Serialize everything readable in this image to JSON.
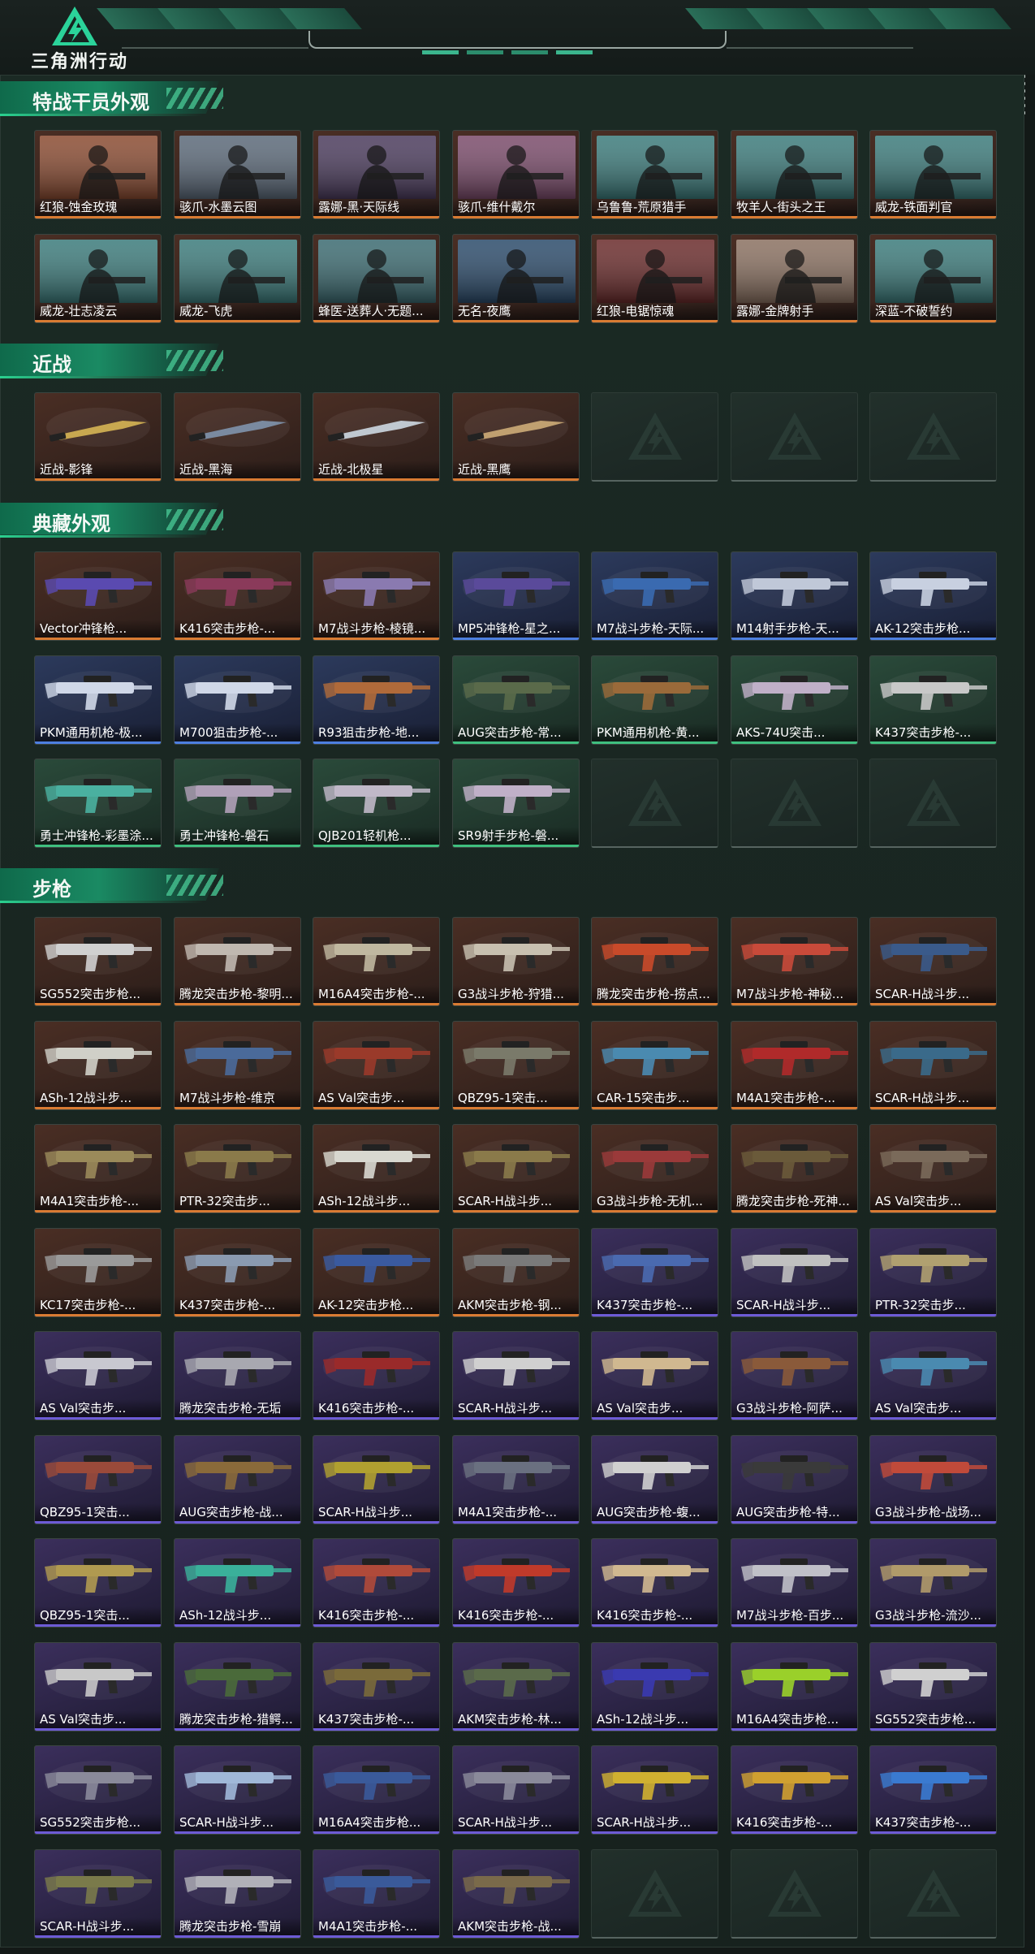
{
  "header": {
    "logo_text": "三角洲行动",
    "logo_icon": "delta-triangle-logo"
  },
  "colors": {
    "accent": "#1a8a63",
    "rarity_orange": "#d97b33",
    "rarity_purple": "#6d5bd6",
    "rarity_blue": "#4d7fe0",
    "rarity_green": "#3fbf7f"
  },
  "sections": [
    {
      "title": "特战干员外观",
      "kind": "operator",
      "empty_count": 0,
      "items": [
        {
          "label": "红狼-蚀金玫瑰",
          "rarity": "orange",
          "thumb": "#8a4a30"
        },
        {
          "label": "骇爪-水墨云图",
          "rarity": "orange",
          "thumb": "#5a6878"
        },
        {
          "label": "露娜-黑·天际线",
          "rarity": "orange",
          "thumb": "#4a3a5c"
        },
        {
          "label": "骇爪-维什戴尔",
          "rarity": "orange",
          "thumb": "#7a4a6a"
        },
        {
          "label": "乌鲁鲁-荒原猎手",
          "rarity": "orange",
          "thumb": "#3a7a7a"
        },
        {
          "label": "牧羊人-街头之王",
          "rarity": "orange",
          "thumb": "#3a7a7a"
        },
        {
          "label": "威龙-铁面判官",
          "rarity": "orange",
          "thumb": "#3a7a7a"
        },
        {
          "label": "威龙-壮志凌云",
          "rarity": "orange",
          "thumb": "#3a7a7a"
        },
        {
          "label": "威龙-飞虎",
          "rarity": "orange",
          "thumb": "#3a7a7a"
        },
        {
          "label": "蜂医-送葬人·无题...",
          "rarity": "orange",
          "thumb": "#3a6a70"
        },
        {
          "label": "无名-夜鹰",
          "rarity": "orange",
          "thumb": "#2a4a6a"
        },
        {
          "label": "红狼-电锯惊魂",
          "rarity": "orange",
          "thumb": "#6a2a2a"
        },
        {
          "label": "露娜-金牌射手",
          "rarity": "orange",
          "thumb": "#8a7060"
        },
        {
          "label": "深蓝-不破誓约",
          "rarity": "orange",
          "thumb": "#3a7a7a"
        }
      ]
    },
    {
      "title": "近战",
      "kind": "melee",
      "empty_count": 3,
      "items": [
        {
          "label": "近战-影锋",
          "rarity": "orange",
          "thumb": "#c8a850"
        },
        {
          "label": "近战-黑海",
          "rarity": "orange",
          "thumb": "#7a8aa0"
        },
        {
          "label": "近战-北极星",
          "rarity": "orange",
          "thumb": "#c0c8d0"
        },
        {
          "label": "近战-黑鹰",
          "rarity": "orange",
          "thumb": "#c0a070"
        }
      ]
    },
    {
      "title": "典藏外观",
      "kind": "weapon",
      "empty_count": 3,
      "items": [
        {
          "label": "Vector冲锋枪...",
          "rarity": "orange",
          "thumb": "#5a4ab0"
        },
        {
          "label": "K416突击步枪-...",
          "rarity": "orange",
          "thumb": "#8a3a5a"
        },
        {
          "label": "M7战斗步枪-棱镜...",
          "rarity": "orange",
          "thumb": "#8a7ab0"
        },
        {
          "label": "MP5冲锋枪-星之...",
          "rarity": "blue",
          "thumb": "#5a4a9a"
        },
        {
          "label": "M7战斗步枪-天际...",
          "rarity": "blue",
          "thumb": "#3a6ab0"
        },
        {
          "label": "M14射手步枪-天...",
          "rarity": "blue",
          "thumb": "#c0c8d8"
        },
        {
          "label": "AK-12突击步枪...",
          "rarity": "blue",
          "thumb": "#c8d0e0"
        },
        {
          "label": "PKM通用机枪-极...",
          "rarity": "blue",
          "thumb": "#d0d8e8"
        },
        {
          "label": "M700狙击步枪-...",
          "rarity": "blue",
          "thumb": "#d0d8e8"
        },
        {
          "label": "R93狙击步枪-地...",
          "rarity": "blue",
          "thumb": "#b06a3a"
        },
        {
          "label": "AUG突击步枪-常...",
          "rarity": "green",
          "thumb": "#5a6a4a"
        },
        {
          "label": "PKM通用机枪-黄...",
          "rarity": "green",
          "thumb": "#9a6a3a"
        },
        {
          "label": "AKS-74U突击...",
          "rarity": "green",
          "thumb": "#c0b0c8"
        },
        {
          "label": "K437突击步枪-...",
          "rarity": "green",
          "thumb": "#c8c8c8"
        },
        {
          "label": "勇士冲锋枪-彩墨涂...",
          "rarity": "green",
          "thumb": "#4ab0a0"
        },
        {
          "label": "勇士冲锋枪-磐石",
          "rarity": "green",
          "thumb": "#b0a0b8"
        },
        {
          "label": "QJB201轻机枪...",
          "rarity": "green",
          "thumb": "#c0b8c8"
        },
        {
          "label": "SR9射手步枪-磐...",
          "rarity": "green",
          "thumb": "#c0b0c8"
        }
      ]
    },
    {
      "title": "步枪",
      "kind": "weapon",
      "empty_count": 3,
      "items": [
        {
          "label": "SG552突击步枪...",
          "rarity": "orange",
          "thumb": "#d0d0d0"
        },
        {
          "label": "腾龙突击步枪-黎明...",
          "rarity": "orange",
          "thumb": "#c0b8b0"
        },
        {
          "label": "M16A4突击步枪-...",
          "rarity": "orange",
          "thumb": "#c0b8a0"
        },
        {
          "label": "G3战斗步枪-狩猎...",
          "rarity": "orange",
          "thumb": "#c8c0b0"
        },
        {
          "label": "腾龙突击步枪-捞点...",
          "rarity": "orange",
          "thumb": "#c84a2a"
        },
        {
          "label": "M7战斗步枪-神秘...",
          "rarity": "orange",
          "thumb": "#c84a3a"
        },
        {
          "label": "SCAR-H战斗步...",
          "rarity": "orange",
          "thumb": "#3a5a8a"
        },
        {
          "label": "ASh-12战斗步...",
          "rarity": "orange",
          "thumb": "#d0d0c8"
        },
        {
          "label": "M7战斗步枪-维京",
          "rarity": "orange",
          "thumb": "#4a6a9a"
        },
        {
          "label": "AS Val突击步...",
          "rarity": "orange",
          "thumb": "#9a3a2a"
        },
        {
          "label": "QBZ95-1突击...",
          "rarity": "orange",
          "thumb": "#7a7a6a"
        },
        {
          "label": "CAR-15突击步...",
          "rarity": "orange",
          "thumb": "#4a8ab0"
        },
        {
          "label": "M4A1突击步枪-...",
          "rarity": "orange",
          "thumb": "#b02a2a"
        },
        {
          "label": "SCAR-H战斗步...",
          "rarity": "orange",
          "thumb": "#3a6a8a"
        },
        {
          "label": "M4A1突击步枪-...",
          "rarity": "orange",
          "thumb": "#9a8a5a"
        },
        {
          "label": "PTR-32突击步...",
          "rarity": "orange",
          "thumb": "#8a7a4a"
        },
        {
          "label": "ASh-12战斗步...",
          "rarity": "orange",
          "thumb": "#d8d8d0"
        },
        {
          "label": "SCAR-H战斗步...",
          "rarity": "orange",
          "thumb": "#8a7a4a"
        },
        {
          "label": "G3战斗步枪-无机...",
          "rarity": "orange",
          "thumb": "#9a3a3a"
        },
        {
          "label": "腾龙突击步枪-死神...",
          "rarity": "orange",
          "thumb": "#6a5a3a"
        },
        {
          "label": "AS Val突击步...",
          "rarity": "orange",
          "thumb": "#7a6a5a"
        },
        {
          "label": "KC17突击步枪-...",
          "rarity": "orange",
          "thumb": "#9a9a9a"
        },
        {
          "label": "K437突击步枪-...",
          "rarity": "orange",
          "thumb": "#8a9ab0"
        },
        {
          "label": "AK-12突击步枪...",
          "rarity": "orange",
          "thumb": "#3a5aa0"
        },
        {
          "label": "AKM突击步枪-钢...",
          "rarity": "orange",
          "thumb": "#7a7a7a"
        },
        {
          "label": "K437突击步枪-...",
          "rarity": "purple",
          "thumb": "#4a6ab0"
        },
        {
          "label": "SCAR-H战斗步...",
          "rarity": "purple",
          "thumb": "#c0c0c0"
        },
        {
          "label": "PTR-32突击步...",
          "rarity": "purple",
          "thumb": "#b0a070"
        },
        {
          "label": "AS Val突击步...",
          "rarity": "purple",
          "thumb": "#c8c8d0"
        },
        {
          "label": "腾龙突击步枪-无垢",
          "rarity": "purple",
          "thumb": "#a8a8b0"
        },
        {
          "label": "K416突击步枪-...",
          "rarity": "purple",
          "thumb": "#9a2a2a"
        },
        {
          "label": "SCAR-H战斗步...",
          "rarity": "purple",
          "thumb": "#d0d0d0"
        },
        {
          "label": "AS Val突击步...",
          "rarity": "purple",
          "thumb": "#d0b890"
        },
        {
          "label": "G3战斗步枪-阿萨...",
          "rarity": "purple",
          "thumb": "#8a5a3a"
        },
        {
          "label": "AS Val突击步...",
          "rarity": "purple",
          "thumb": "#4a8ab0"
        },
        {
          "label": "QBZ95-1突击...",
          "rarity": "purple",
          "thumb": "#9a4a3a"
        },
        {
          "label": "AUG突击步枪-战...",
          "rarity": "purple",
          "thumb": "#8a6a3a"
        },
        {
          "label": "SCAR-H战斗步...",
          "rarity": "purple",
          "thumb": "#b0a030"
        },
        {
          "label": "M4A1突击步枪-...",
          "rarity": "purple",
          "thumb": "#6a7080"
        },
        {
          "label": "AUG突击步枪-蝮...",
          "rarity": "purple",
          "thumb": "#d0d0d0"
        },
        {
          "label": "AUG突击步枪-特...",
          "rarity": "purple",
          "thumb": "#3a3a3a"
        },
        {
          "label": "G3战斗步枪-战场...",
          "rarity": "purple",
          "thumb": "#c04a3a"
        },
        {
          "label": "QBZ95-1突击...",
          "rarity": "purple",
          "thumb": "#b09a50"
        },
        {
          "label": "ASh-12战斗步...",
          "rarity": "purple",
          "thumb": "#3ab09a"
        },
        {
          "label": "K416突击步枪-...",
          "rarity": "purple",
          "thumb": "#b04a3a"
        },
        {
          "label": "K416突击步枪-...",
          "rarity": "purple",
          "thumb": "#c03a2a"
        },
        {
          "label": "K416突击步枪-...",
          "rarity": "purple",
          "thumb": "#d0b890"
        },
        {
          "label": "M7战斗步枪-百步...",
          "rarity": "purple",
          "thumb": "#c0c0c8"
        },
        {
          "label": "G3战斗步枪-流沙...",
          "rarity": "purple",
          "thumb": "#b09a6a"
        },
        {
          "label": "AS Val突击步...",
          "rarity": "purple",
          "thumb": "#c8c8c8"
        },
        {
          "label": "腾龙突击步枪-猎鳄...",
          "rarity": "purple",
          "thumb": "#4a6a3a"
        },
        {
          "label": "K437突击步枪-...",
          "rarity": "purple",
          "thumb": "#7a6a3a"
        },
        {
          "label": "AKM突击步枪-林...",
          "rarity": "purple",
          "thumb": "#5a6a4a"
        },
        {
          "label": "ASh-12战斗步...",
          "rarity": "purple",
          "thumb": "#3a3ab0"
        },
        {
          "label": "M16A4突击步枪...",
          "rarity": "purple",
          "thumb": "#9ad02a"
        },
        {
          "label": "SG552突击步枪...",
          "rarity": "purple",
          "thumb": "#d0d0d0"
        },
        {
          "label": "SG552突击步枪...",
          "rarity": "purple",
          "thumb": "#8a8a9a"
        },
        {
          "label": "SCAR-H战斗步...",
          "rarity": "purple",
          "thumb": "#a0b8d8"
        },
        {
          "label": "M16A4突击步枪...",
          "rarity": "purple",
          "thumb": "#3a5a9a"
        },
        {
          "label": "SCAR-H战斗步...",
          "rarity": "purple",
          "thumb": "#8a8a9a"
        },
        {
          "label": "SCAR-H战斗步...",
          "rarity": "purple",
          "thumb": "#d0b030"
        },
        {
          "label": "K416突击步枪-...",
          "rarity": "purple",
          "thumb": "#d0a030"
        },
        {
          "label": "K437突击步枪-...",
          "rarity": "purple",
          "thumb": "#3a7ad0"
        },
        {
          "label": "SCAR-H战斗步...",
          "rarity": "purple",
          "thumb": "#7a7a4a"
        },
        {
          "label": "腾龙突击步枪-雪崩",
          "rarity": "purple",
          "thumb": "#b0b0b8"
        },
        {
          "label": "M4A1突击步枪-...",
          "rarity": "purple",
          "thumb": "#3a5a9a"
        },
        {
          "label": "AKM突击步枪-战...",
          "rarity": "purple",
          "thumb": "#7a6a4a"
        }
      ]
    }
  ]
}
